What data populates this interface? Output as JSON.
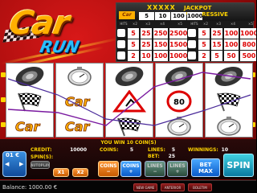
{
  "logo": {
    "word1": "Car",
    "word2": "RUN"
  },
  "paytable": {
    "jackpot_label": "JACKPOT PROGRESSIVE",
    "stars": "XXXXX",
    "jackpot_values": [
      "5",
      "10",
      "100",
      "1000"
    ],
    "columns": [
      "HITS",
      "×2",
      "×3",
      "×4",
      "×5"
    ],
    "left_rows": [
      [
        "5",
        "25",
        "250",
        "2500"
      ],
      [
        "5",
        "25",
        "150",
        "1500"
      ],
      [
        "2",
        "10",
        "100",
        "1000"
      ]
    ],
    "right_rows": [
      [
        "5",
        "25",
        "100",
        "1000"
      ],
      [
        "5",
        "15",
        "100",
        "800"
      ],
      [
        "2",
        "5",
        "50",
        "500"
      ]
    ]
  },
  "reels": {
    "symbols": [
      [
        "tire-icon",
        "flag-icon",
        "car-logo-icon"
      ],
      [
        "stopwatch-icon",
        "car-logo-icon",
        "car-logo-icon"
      ],
      [
        "tire-icon",
        "warning-sign-icon",
        "flag-icon"
      ],
      [
        "tire-icon",
        "speed-sign-icon",
        "stopwatch-icon"
      ],
      [
        "tire-icon",
        "flag-icon",
        "stopwatch-icon"
      ]
    ]
  },
  "info": {
    "win_message": "YOU WIN 10 COIN(S)",
    "credit_label": "CREDIT:",
    "credit_value": "10000",
    "coins_label": "COINS:",
    "coins_value": "5",
    "lines_label": "LINES:",
    "lines_value": "5",
    "spins_label": "SPIN(S):",
    "bet_label": "BET:",
    "bet_value": "25",
    "winnings_label": "WINNINGS:",
    "winnings_value": "10",
    "coin_value": "01 €"
  },
  "buttons": {
    "coins_minus": "COINS\n−",
    "coins_plus": "COINS\n+",
    "lines_minus": "LINES\n−",
    "lines_plus": "LINES\n+",
    "bet_max": "BET\nMAX",
    "spin": "SPIN",
    "autoplay": "AUTOPLAY",
    "x1": "X1",
    "x2": "X2"
  },
  "bottom": {
    "balance_label": "Balance:",
    "balance_value": "1000.00 €",
    "btn1": "NEW GAME",
    "btn2": "ANTERIOR",
    "btn3": "BOLETIM"
  },
  "colors": {
    "accent": "#ffd400",
    "background": "#b01010",
    "spin": "#1a6ad0"
  }
}
